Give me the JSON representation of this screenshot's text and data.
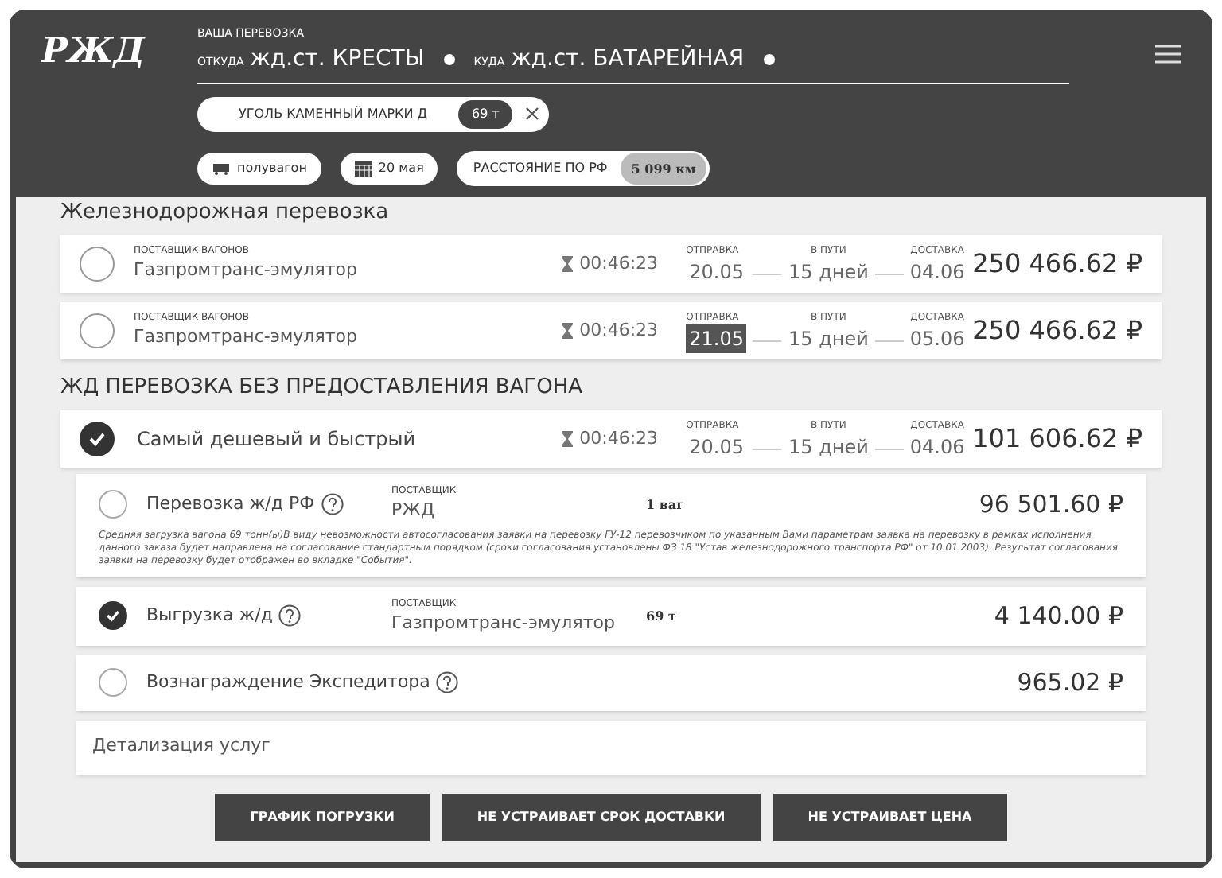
{
  "header": {
    "logo": "РЖД",
    "caption": "ВАША ПЕРЕВОЗКА",
    "from_label": "ОТКУДА",
    "from": "жд.ст. КРЕСТЫ",
    "to_label": "КУДА",
    "to": "жд.ст. БАТАРЕЙНАЯ"
  },
  "cargo": {
    "name": "УГОЛЬ КАМЕННЫЙ МАРКИ Д",
    "weight": "69 т"
  },
  "filters": {
    "wagon": "полувагон",
    "date": "20 мая",
    "distance_label": "РАССТОЯНИЕ ПО РФ",
    "distance": "5 099 км"
  },
  "rail_section": {
    "title": "Железнодорожная перевозка",
    "offers": [
      {
        "selected": false,
        "supplier_label": "ПОСТАВЩИК ВАГОНОВ",
        "supplier": "Газпромтранс-эмулятор",
        "timer": "00:46:23",
        "departure_label": "ОТПРАВКА",
        "departure": "20.05",
        "departure_highlighted": false,
        "transit_label": "В ПУТИ",
        "transit": "15 дней",
        "delivery_label": "ДОСТАВКА",
        "delivery": "04.06",
        "price": "250 466.62 ₽"
      },
      {
        "selected": false,
        "supplier_label": "ПОСТАВЩИК ВАГОНОВ",
        "supplier": "Газпромтранс-эмулятор",
        "timer": "00:46:23",
        "departure_label": "ОТПРАВКА",
        "departure": "21.05",
        "departure_highlighted": true,
        "transit_label": "В ПУТИ",
        "transit": "15 дней",
        "delivery_label": "ДОСТАВКА",
        "delivery": "05.06",
        "price": "250 466.62 ₽"
      }
    ]
  },
  "no_wagon_section": {
    "title": "ЖД ПЕРЕВОЗКА БЕЗ ПРЕДОСТАВЛЕНИЯ ВАГОНА",
    "offer": {
      "selected": true,
      "name": "Самый дешевый и быстрый",
      "timer": "00:46:23",
      "departure_label": "ОТПРАВКА",
      "departure": "20.05",
      "transit_label": "В ПУТИ",
      "transit": "15 дней",
      "delivery_label": "ДОСТАВКА",
      "delivery": "04.06",
      "price": "101 606.62 ₽"
    },
    "services": [
      {
        "checked": false,
        "name": "Перевозка ж/д РФ",
        "supplier_label": "ПОСТАВЩИК",
        "supplier": "РЖД",
        "quantity": "1 ваг",
        "price": "96 501.60 ₽",
        "note": "Средняя загрузка вагона 69 тонн(ы)В виду невозможности автосогласования заявки на перевозку ГУ-12 перевозчиком по указанным Вами параметрам заявка на перевозку в рамках исполнения данного заказа будет направлена на согласование стандартным порядком (сроки согласования установлены ФЗ 18 \"Устав железнодорожного транспорта РФ\" от 10.01.2003). Результат согласования заявки на перевозку будет отображен во вкладке \"События\"."
      },
      {
        "checked": true,
        "name": "Выгрузка ж/д",
        "supplier_label": "ПОСТАВЩИК",
        "supplier": "Газпромтранс-эмулятор",
        "quantity": "69 т",
        "price": "4 140.00 ₽"
      },
      {
        "checked": false,
        "name": "Вознаграждение Экспедитора",
        "price": "965.02 ₽"
      }
    ],
    "details": "Детализация услуг"
  },
  "buttons": [
    "ГРАФИК ПОГРУЗКИ",
    "НЕ УСТРАИВАЕТ СРОК ДОСТАВКИ",
    "НЕ УСТРАИВАЕТ ЦЕНА"
  ]
}
